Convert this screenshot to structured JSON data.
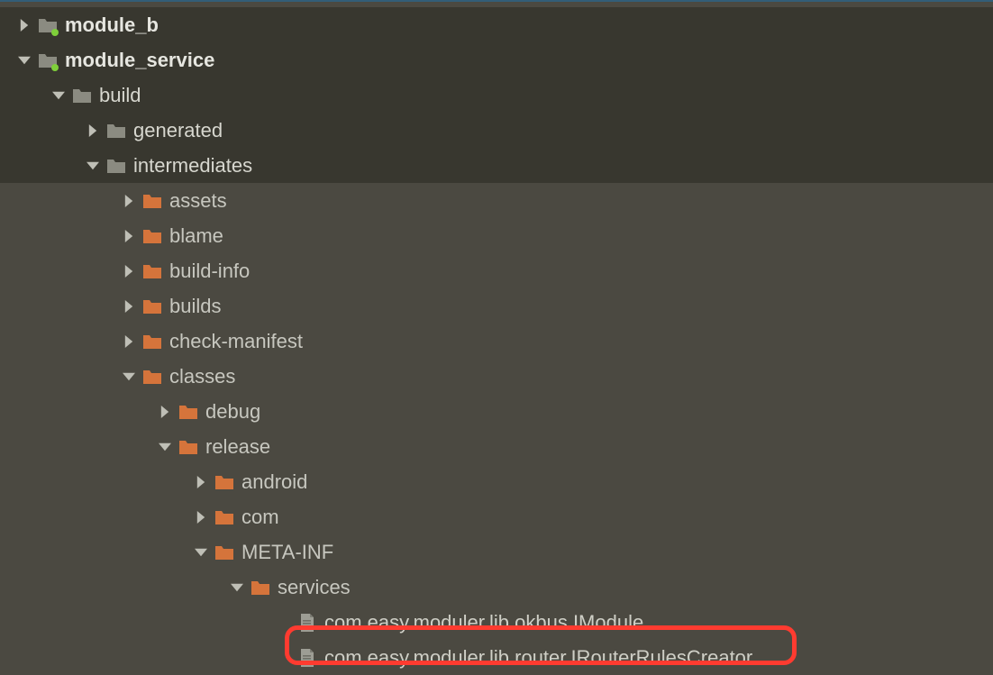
{
  "tree": {
    "module_b": "module_b",
    "module_service": "module_service",
    "build": "build",
    "generated": "generated",
    "intermediates": "intermediates",
    "assets": "assets",
    "blame": "blame",
    "build_info": "build-info",
    "builds": "builds",
    "check_manifest": "check-manifest",
    "classes": "classes",
    "debug": "debug",
    "release": "release",
    "android": "android",
    "com": "com",
    "meta_inf": "META-INF",
    "services": "services",
    "file1": "com.easy.moduler.lib.okbus.IModule",
    "file2": "com.easy.moduler.lib.router.IRouterRulesCreator"
  },
  "colors": {
    "folder_orange": "#d5743b",
    "folder_gray": "#8b8b81",
    "file_gray": "#9d9d94",
    "arrow": "#bfbfb6",
    "dot": "#7fcf3a",
    "highlight": "#ff3b30"
  }
}
